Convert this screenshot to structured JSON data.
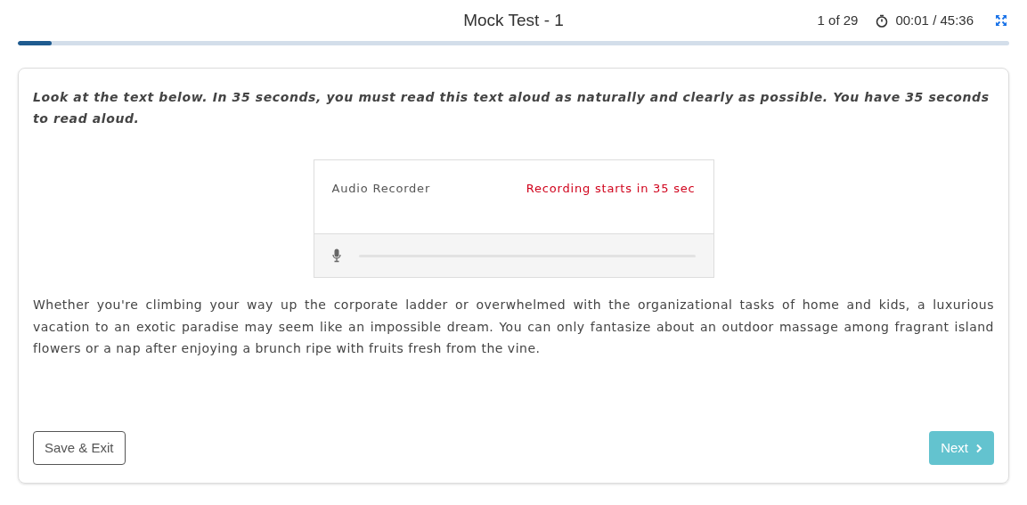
{
  "header": {
    "title": "Mock Test - 1",
    "counter": "1 of 29",
    "timer": "00:01 / 45:36"
  },
  "progress": {
    "level": 0.034
  },
  "instruction": "Look at the text below. In 35 seconds, you must read this text aloud as naturally and clearly as possible. You have 35 seconds to read aloud.",
  "recorder": {
    "title": "Audio Recorder",
    "status": "Recording starts in 35 sec",
    "level": 0
  },
  "passage": "Whether you're climbing your way up the corporate ladder or overwhelmed with the organizational tasks of home and kids, a luxurious vacation to an exotic paradise may seem like an impossible dream. You can only fantasize about an outdoor massage among fragrant island flowers or a nap after enjoying a brunch ripe with fruits fresh from the vine.",
  "buttons": {
    "save": "Save & Exit",
    "next": {
      "label": "Next",
      "disabled": true
    }
  }
}
